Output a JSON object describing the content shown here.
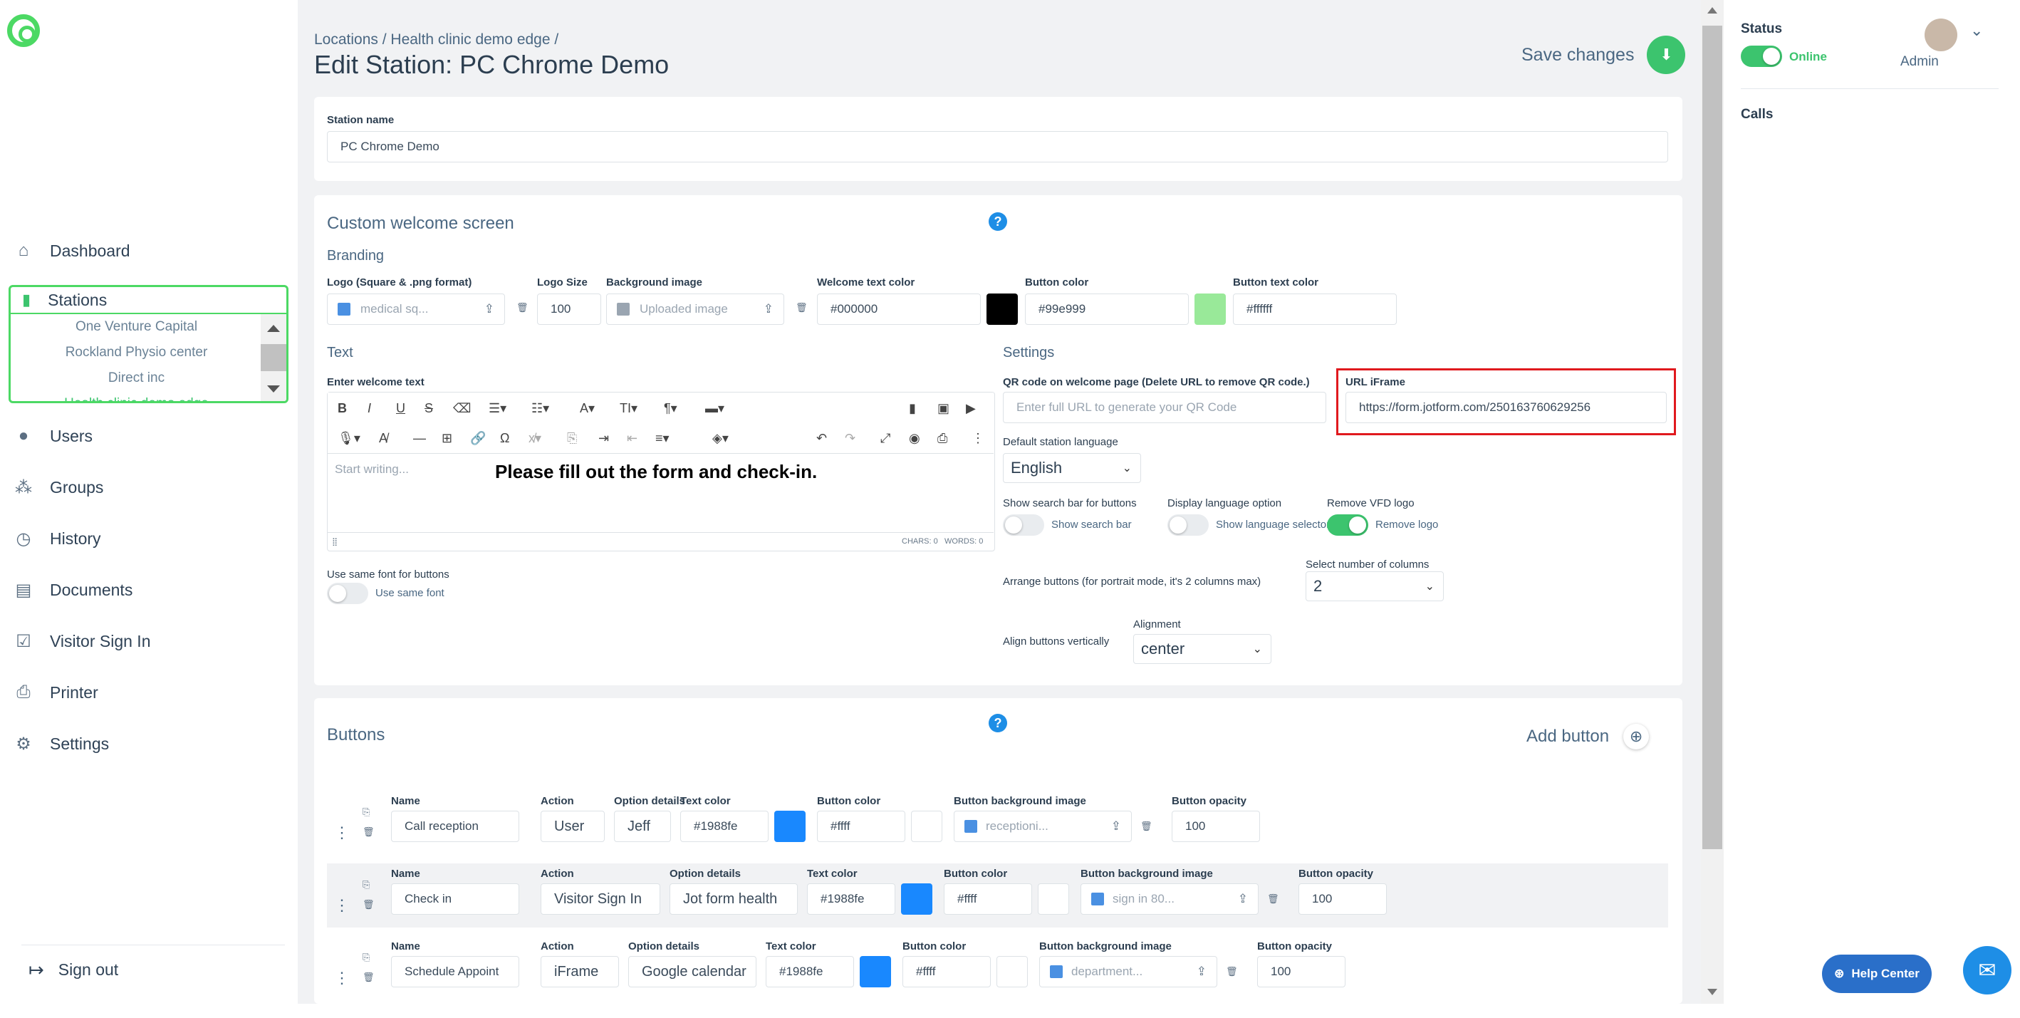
{
  "sidebar": {
    "nav": [
      {
        "label": "Dashboard",
        "icon": "home-icon"
      },
      {
        "label": "Stations",
        "icon": "tablet-icon"
      },
      {
        "label": "Users",
        "icon": "user-icon"
      },
      {
        "label": "Groups",
        "icon": "groups-icon"
      },
      {
        "label": "History",
        "icon": "clock-icon"
      },
      {
        "label": "Documents",
        "icon": "document-icon"
      },
      {
        "label": "Visitor Sign In",
        "icon": "clipboard-check-icon"
      },
      {
        "label": "Printer",
        "icon": "printer-icon"
      },
      {
        "label": "Settings",
        "icon": "gear-icon"
      }
    ],
    "stations_list": [
      "One Venture Capital",
      "Rockland Physio center",
      "Direct inc",
      "Health clinic demo edge"
    ],
    "sign_out": "Sign out"
  },
  "header": {
    "breadcrumb": "Locations / Health clinic demo edge /",
    "title": "Edit Station: PC Chrome Demo",
    "save": "Save changes"
  },
  "station": {
    "label": "Station name",
    "value": "PC Chrome Demo"
  },
  "welcome": {
    "title": "Custom welcome screen",
    "branding": "Branding",
    "logo_label": "Logo (Square & .png format)",
    "logo_value": "medical sq...",
    "logo_size_label": "Logo Size",
    "logo_size": "100",
    "bg_label": "Background image",
    "bg_value": "Uploaded image",
    "welcome_color_label": "Welcome text color",
    "welcome_color": "#000000",
    "button_color_label": "Button color",
    "button_color": "#99e999",
    "button_text_color_label": "Button text color",
    "button_text_color": "#ffffff",
    "text_section": "Text",
    "enter_text_label": "Enter welcome text",
    "editor_placeholder": "Start writing...",
    "editor_content": "Please fill out the form and check-in.",
    "chars": "CHARS: 0",
    "words": "WORDS: 0",
    "same_font_label": "Use same font for buttons",
    "same_font_toggle": "Use same font",
    "settings_section": "Settings",
    "qr_label": "QR code on welcome page (Delete URL to remove QR code.)",
    "qr_placeholder": "Enter full URL to generate your QR Code",
    "iframe_label": "URL iFrame",
    "iframe_value": "https://form.jotform.com/250163760629256",
    "lang_label": "Default station language",
    "lang_value": "English",
    "search_label": "Show search bar for buttons",
    "search_toggle": "Show search bar",
    "display_lang_label": "Display language option",
    "display_lang_toggle": "Show language selector",
    "remove_vfd_label": "Remove VFD logo",
    "remove_vfd_toggle": "Remove logo",
    "arrange_label": "Arrange buttons (for portrait mode, it's 2 columns max)",
    "columns_label": "Select number of columns",
    "columns_value": "2",
    "align_label": "Align buttons vertically",
    "alignment_label": "Alignment",
    "alignment_value": "center"
  },
  "buttons": {
    "title": "Buttons",
    "add": "Add button",
    "rows": [
      {
        "name_lbl": "Name",
        "name": "Call reception",
        "action_lbl": "Action",
        "action": "User",
        "opt_lbl": "Option details",
        "opt": "Jeff",
        "tc_lbl": "Text color",
        "tc": "#1988fe",
        "bc_lbl": "Button color",
        "bc": "#ffff",
        "bg_lbl": "Button background image",
        "bg": "receptioni...",
        "op_lbl": "Button opacity",
        "op": "100"
      },
      {
        "name_lbl": "Name",
        "name": "Check in",
        "action_lbl": "Action",
        "action": "Visitor Sign In",
        "opt_lbl": "Option details",
        "opt": "Jot form health",
        "tc_lbl": "Text color",
        "tc": "#1988fe",
        "bc_lbl": "Button color",
        "bc": "#ffff",
        "bg_lbl": "Button background image",
        "bg": "sign in 80...",
        "op_lbl": "Button opacity",
        "op": "100"
      },
      {
        "name_lbl": "Name",
        "name": "Schedule Appoint",
        "action_lbl": "Action",
        "action": "iFrame",
        "opt_lbl": "Option details",
        "opt": "Google calendar",
        "tc_lbl": "Text color",
        "tc": "#1988fe",
        "bc_lbl": "Button color",
        "bc": "#ffff",
        "bg_lbl": "Button background image",
        "bg": "department...",
        "op_lbl": "Button opacity",
        "op": "100"
      }
    ]
  },
  "right": {
    "status": "Status",
    "online": "Online",
    "admin": "Admin",
    "calls": "Calls",
    "help": "Help Center"
  },
  "colors": {
    "accent": "#3cc46e",
    "blue": "#1988fe",
    "highlight": "#e0191e",
    "swatch_green": "#99e999"
  }
}
